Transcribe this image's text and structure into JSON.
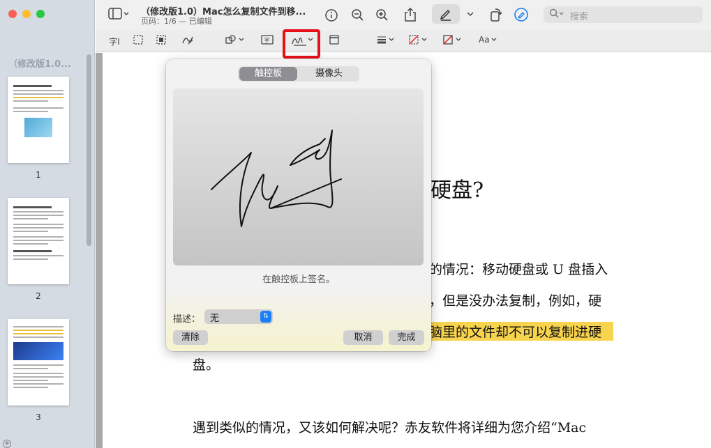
{
  "window": {
    "doc_title": "（修改版1.0）Mac怎么复制文件到移...",
    "doc_subtitle": "页码：1/6 — 已编辑"
  },
  "search": {
    "placeholder": "搜索"
  },
  "sidebar": {
    "title": "（修改版1.0...",
    "pages": [
      "1",
      "2",
      "3"
    ]
  },
  "toolbar": {
    "icons": [
      "sidebar-toggle-icon",
      "info-icon",
      "zoom-out-icon",
      "zoom-in-icon",
      "share-icon",
      "markup-pen-icon",
      "rotate-icon",
      "annotate-icon",
      "search-icon"
    ],
    "markup_icons": [
      "text-selection-icon",
      "rect-select-icon",
      "smart-lasso-icon",
      "sketch-icon",
      "shapes-icon",
      "text-box-icon",
      "sign-icon",
      "note-icon",
      "line-style-icon",
      "border-color-icon",
      "fill-color-icon",
      "text-style-icon"
    ]
  },
  "popover": {
    "tab_trackpad": "触控板",
    "tab_camera": "摄像头",
    "hint": "在触控板上签名。",
    "desc_label": "描述：",
    "desc_value": "无",
    "clear": "清除",
    "cancel": "取消",
    "done": "完成"
  },
  "document": {
    "heading_tail": "硬盘?",
    "line1": "的情况：移动硬盘或 U 盘插入",
    "line2": "，但是没办法复制，例如，硬",
    "line3": "脑里的文件却不可以复制进硬",
    "line4": "盘。",
    "line5": "遇到类似的情况，又该如何解决呢？赤友软件将详细为您介绍“Mac"
  },
  "colors": {
    "accent": "#1b7ff5",
    "highlight": "#f8d34e",
    "callout": "#e8101a"
  }
}
